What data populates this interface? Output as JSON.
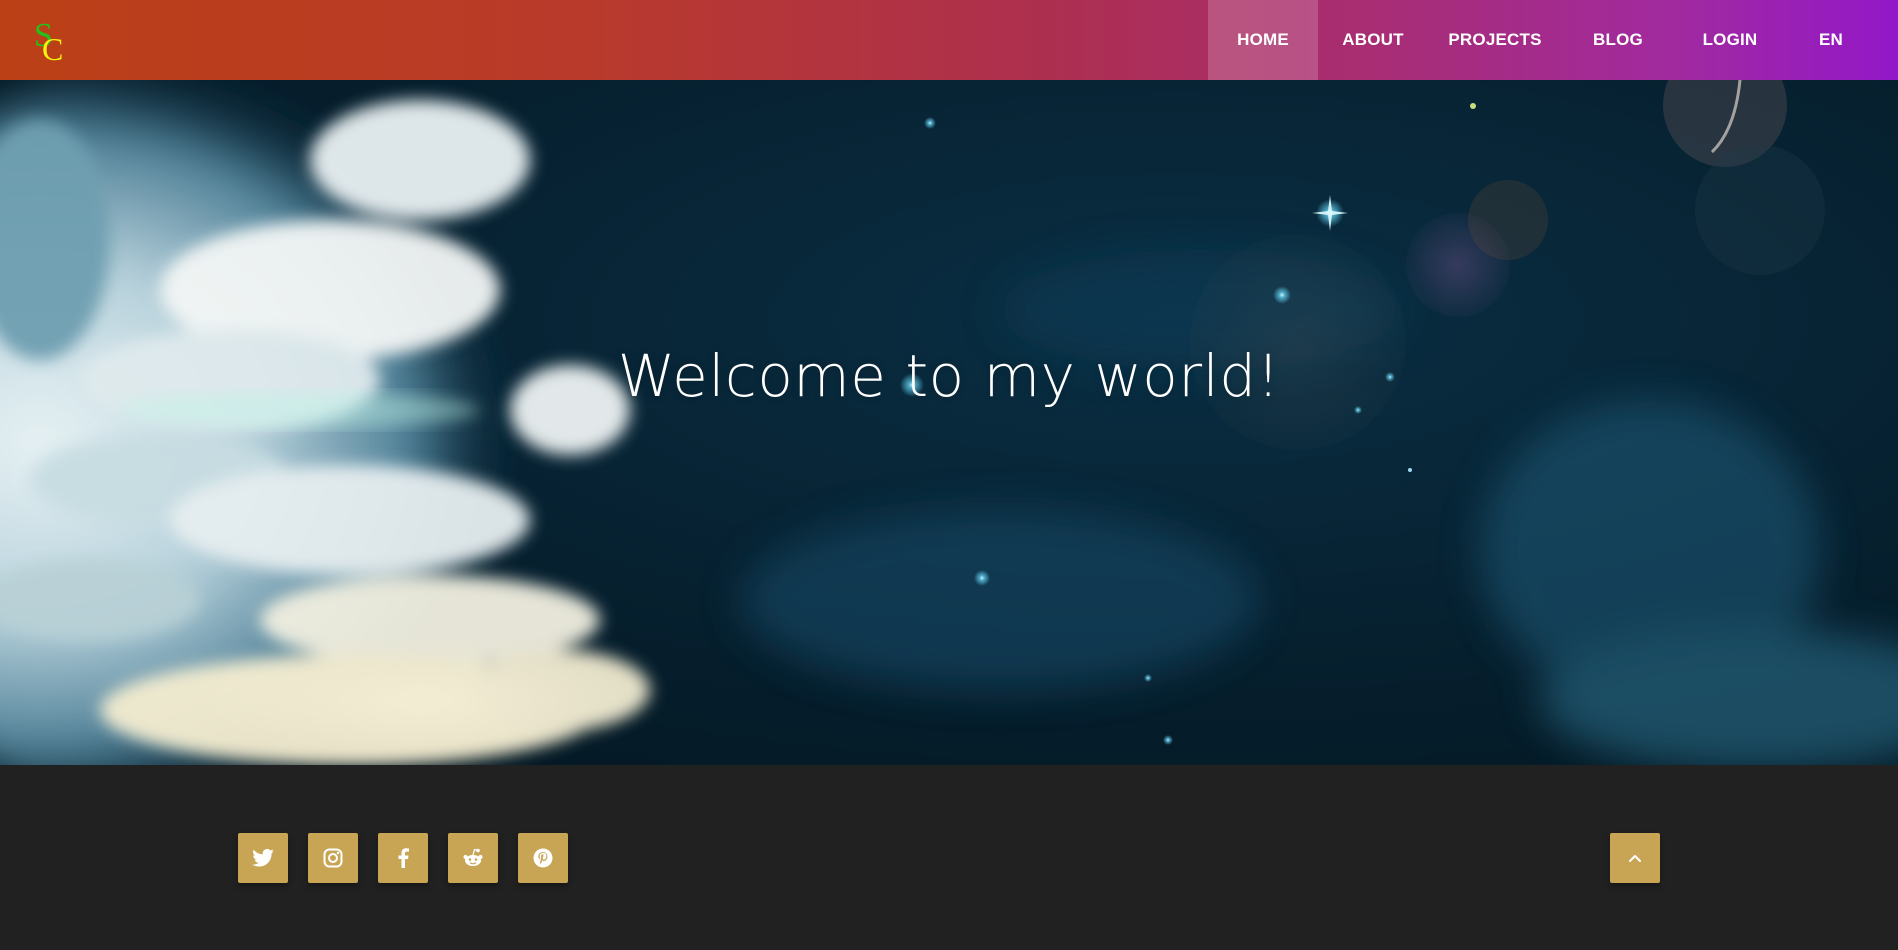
{
  "header": {
    "logo_icon": "sc-monogram-logo",
    "brand_colors": {
      "logo_s": "#22c21a",
      "logo_c": "#f5f20e"
    },
    "nav": [
      {
        "label": "HOME",
        "active": true
      },
      {
        "label": "ABOUT",
        "active": false
      },
      {
        "label": "PROJECTS",
        "active": false
      },
      {
        "label": "BLOG",
        "active": false
      },
      {
        "label": "LOGIN",
        "active": false
      },
      {
        "label": "EN",
        "active": false
      }
    ],
    "gradient": [
      "#bb4016",
      "#ad2f4f",
      "#a12a9e",
      "#9318c9"
    ]
  },
  "hero": {
    "title": "Welcome to my world!",
    "background": "clouds-and-night-sky-illustration"
  },
  "footer": {
    "social_links": [
      {
        "icon": "twitter-icon"
      },
      {
        "icon": "instagram-icon"
      },
      {
        "icon": "facebook-icon"
      },
      {
        "icon": "reddit-icon"
      },
      {
        "icon": "pinterest-icon"
      }
    ],
    "back_to_top_icon": "chevron-up-icon",
    "accent": "#c8a555",
    "background": "#212121"
  }
}
